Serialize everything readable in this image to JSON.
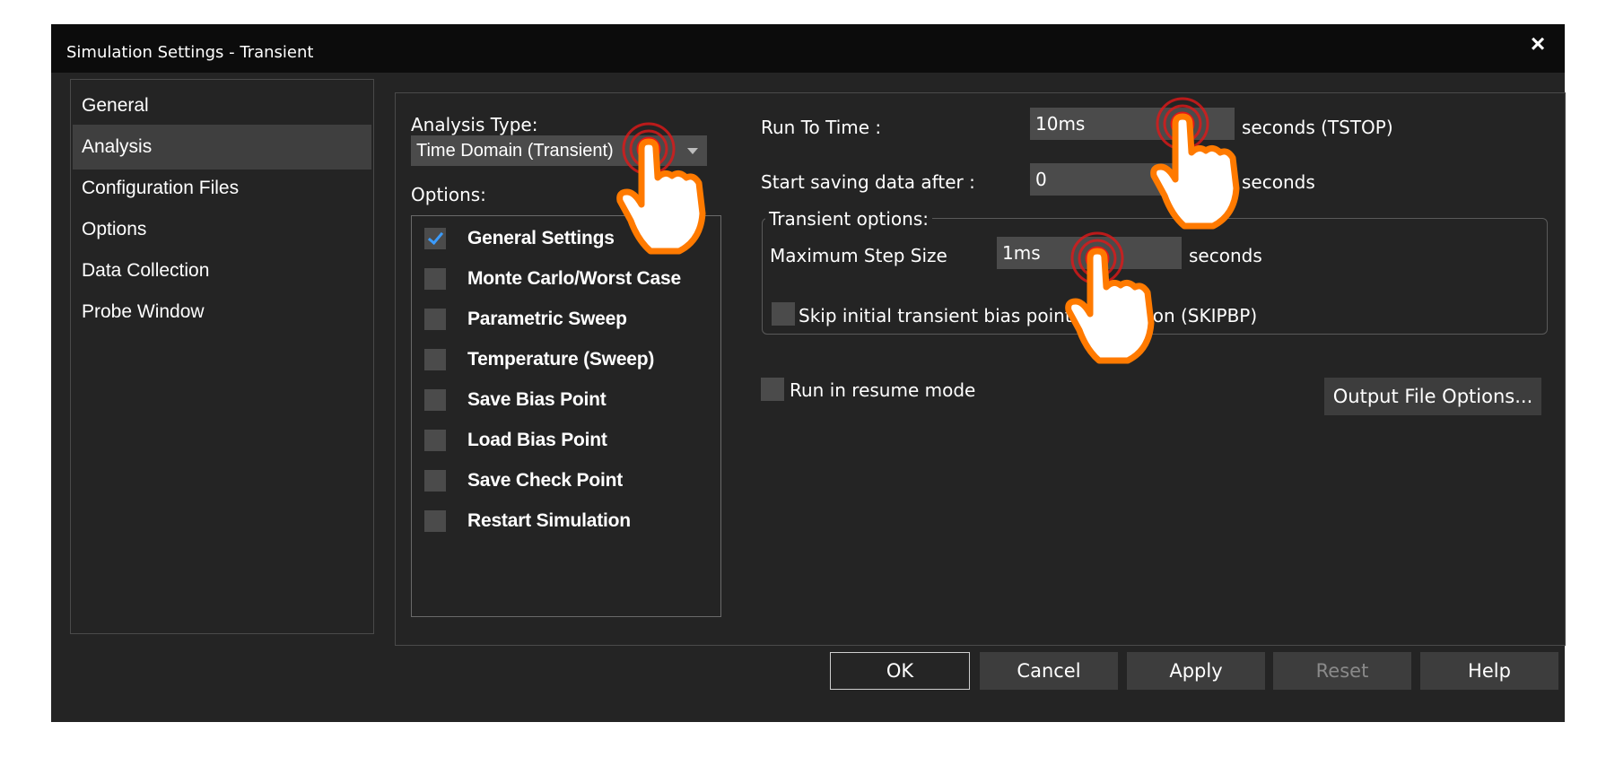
{
  "window": {
    "title": "Simulation Settings - Transient",
    "close_glyph": "×"
  },
  "nav": {
    "items": [
      {
        "label": "General"
      },
      {
        "label": "Analysis",
        "active": true
      },
      {
        "label": "Configuration Files"
      },
      {
        "label": "Options"
      },
      {
        "label": "Data Collection"
      },
      {
        "label": "Probe Window"
      }
    ]
  },
  "analysis": {
    "type_label": "Analysis Type:",
    "type_value": "Time Domain (Transient)",
    "options_label": "Options:",
    "options": [
      {
        "label": "General Settings",
        "checked": true
      },
      {
        "label": "Monte Carlo/Worst Case",
        "checked": false
      },
      {
        "label": "Parametric Sweep",
        "checked": false
      },
      {
        "label": "Temperature (Sweep)",
        "checked": false
      },
      {
        "label": "Save Bias Point",
        "checked": false
      },
      {
        "label": "Load Bias Point",
        "checked": false
      },
      {
        "label": "Save Check Point",
        "checked": false
      },
      {
        "label": "Restart Simulation",
        "checked": false
      }
    ]
  },
  "settings": {
    "run_to_time_label": "Run To Time :",
    "run_to_time_value": "10ms",
    "run_to_time_unit": "seconds (TSTOP)",
    "start_saving_label": "Start saving data after :",
    "start_saving_value": "0",
    "start_saving_unit": "seconds",
    "transient_options_label": "Transient options:",
    "max_step_label": "Maximum Step Size",
    "max_step_value": "1ms",
    "max_step_unit": "seconds",
    "skip_bias_label": "Skip initial transient bias point calculation (SKIPBP)",
    "resume_label": "Run in resume mode",
    "output_file_button": "Output File Options..."
  },
  "buttons": {
    "ok": "OK",
    "cancel": "Cancel",
    "apply": "Apply",
    "reset": "Reset",
    "help": "Help"
  },
  "colors": {
    "dialog_bg": "#242424",
    "titlebar_bg": "#0c0c0c",
    "field_bg": "#4b4b4b",
    "check_accent": "#3b9cff",
    "cursor_orange": "#ff7a00",
    "ring_red": "#e01818"
  }
}
